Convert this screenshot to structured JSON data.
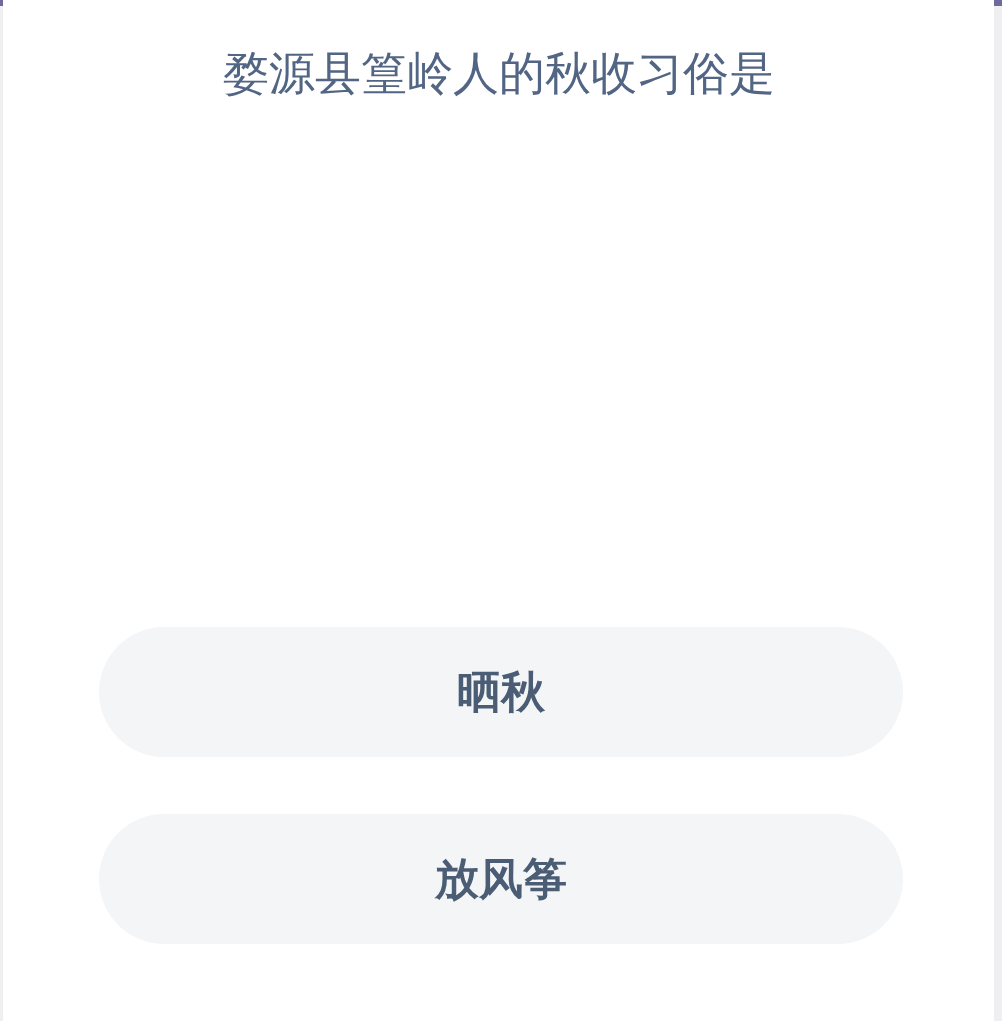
{
  "question": "婺源县篁岭人的秋收习俗是",
  "options": [
    {
      "label": "晒秋"
    },
    {
      "label": "放风筝"
    }
  ]
}
